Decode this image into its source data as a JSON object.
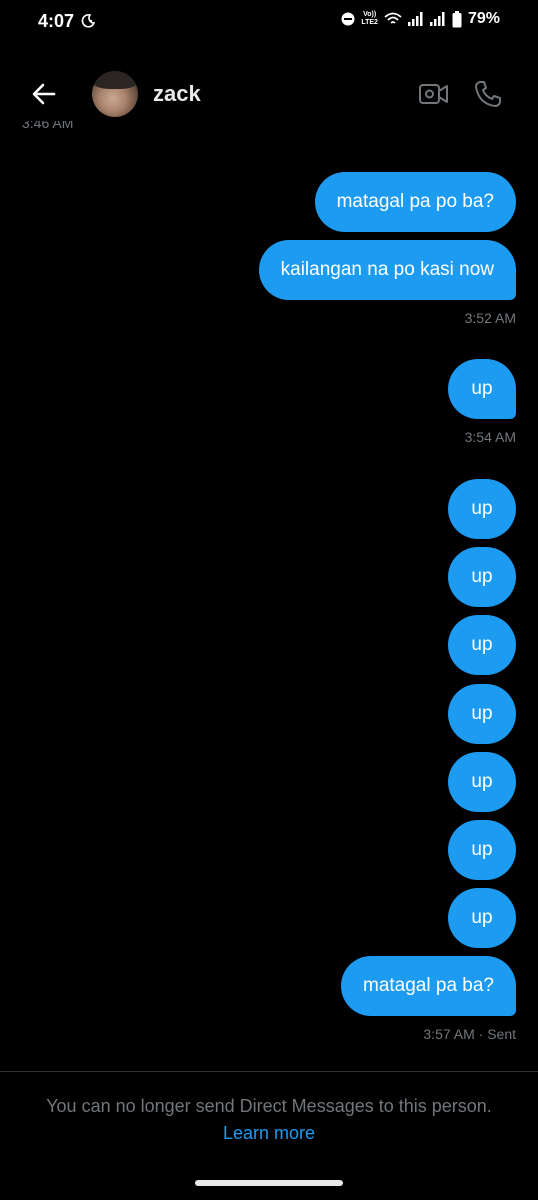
{
  "status_bar": {
    "time": "4:07",
    "network_line1": "Vo))",
    "network_line2": "LTE2",
    "battery": "79%"
  },
  "header": {
    "contact_name": "zack",
    "icons": [
      "back-arrow-icon",
      "video-camera-icon",
      "phone-icon"
    ]
  },
  "earlier_timestamp": "3:46 AM",
  "messages": [
    {
      "text": "matagal pa po ba?",
      "tail": false
    },
    {
      "text": "kailangan na po kasi now",
      "tail": true
    },
    {
      "timestamp": "3:52 AM"
    },
    {
      "text": "up",
      "tail": true
    },
    {
      "timestamp": "3:54 AM"
    },
    {
      "text": "up",
      "tail": false
    },
    {
      "text": "up",
      "tail": false
    },
    {
      "text": "up",
      "tail": false
    },
    {
      "text": "up",
      "tail": false
    },
    {
      "text": "up",
      "tail": false
    },
    {
      "text": "up",
      "tail": false
    },
    {
      "text": "up",
      "tail": false
    },
    {
      "text": "matagal pa ba?",
      "tail": true
    },
    {
      "timestamp": "3:57 AM · Sent"
    }
  ],
  "footer": {
    "notice": "You can no longer send Direct Messages to this person.",
    "link": "Learn more"
  },
  "colors": {
    "background": "#000000",
    "bubble": "#1d9bf0",
    "muted_text": "#71767b",
    "link": "#1d9bf0"
  }
}
